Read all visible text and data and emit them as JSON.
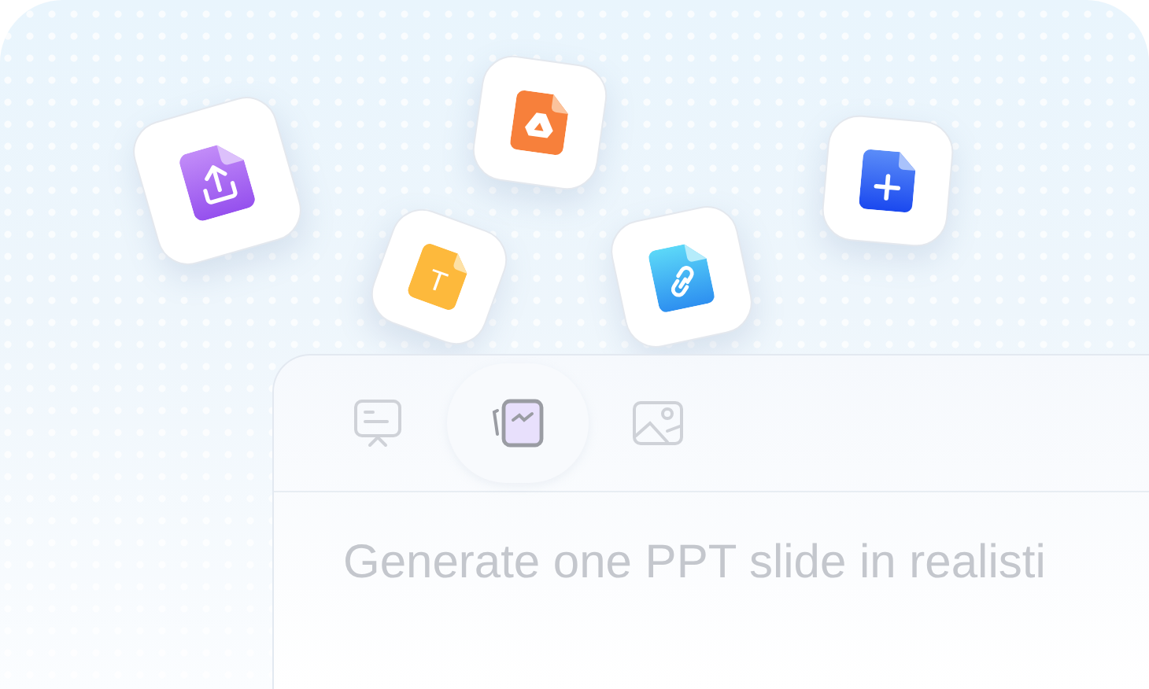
{
  "file_cards": [
    {
      "kind": "upload"
    },
    {
      "kind": "drive"
    },
    {
      "kind": "text",
      "glyph": "T"
    },
    {
      "kind": "link"
    },
    {
      "kind": "add"
    }
  ],
  "panel": {
    "tabs": [
      {
        "kind": "presentation",
        "selected": false
      },
      {
        "kind": "image-gen",
        "selected": true
      },
      {
        "kind": "picture",
        "selected": false
      }
    ],
    "prompt": {
      "placeholder": "Generate one PPT slide in realisti"
    }
  }
}
